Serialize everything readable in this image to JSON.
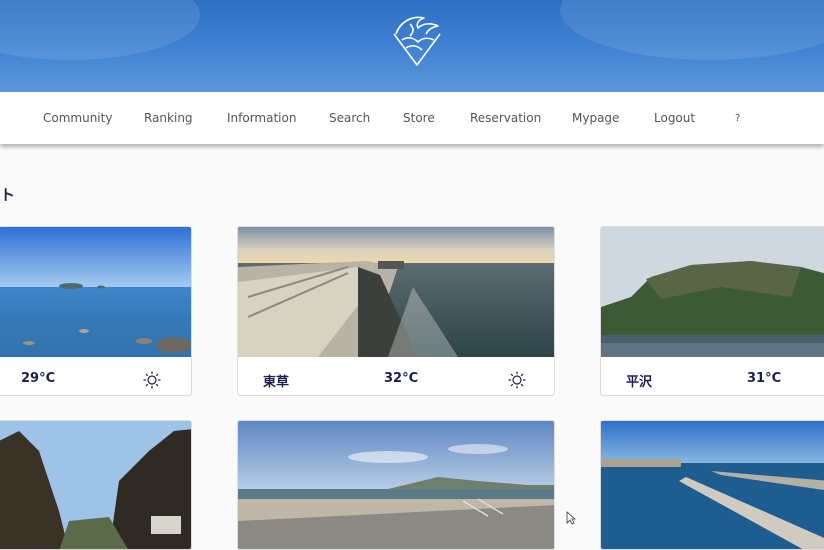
{
  "nav": {
    "items": [
      "Community",
      "Ranking",
      "Information",
      "Search",
      "Store",
      "Reservation",
      "Mypage",
      "Logout",
      "?"
    ]
  },
  "section": {
    "title": "ト"
  },
  "cards": [
    {
      "name": "",
      "temp": "29°C",
      "weather_icon": "sun-icon"
    },
    {
      "name": "東草",
      "temp": "32°C",
      "weather_icon": "sun-icon"
    },
    {
      "name": "平沢",
      "temp": "31°C",
      "weather_icon": ""
    }
  ],
  "colors": {
    "header": "#3d7fd0",
    "text": "#1a1f4e",
    "nav_text": "#555555"
  }
}
